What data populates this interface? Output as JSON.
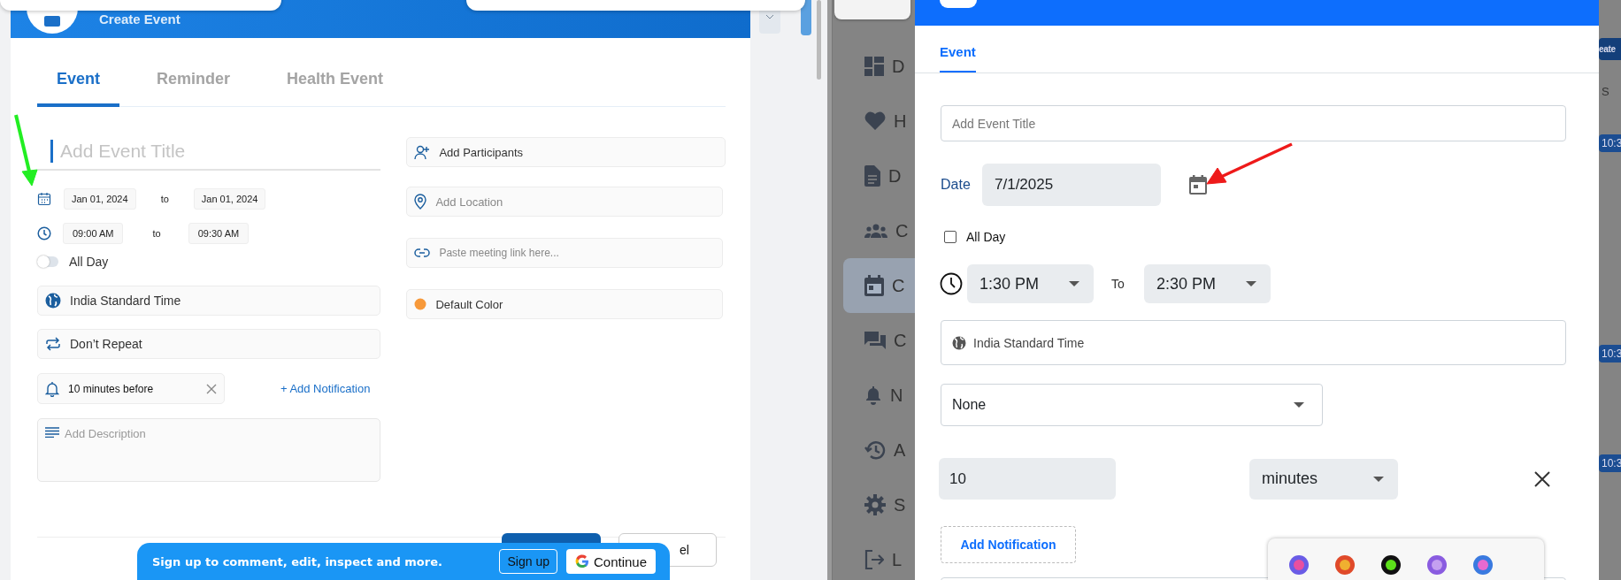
{
  "left_screen": {
    "header": {
      "title": "Create Event"
    },
    "tabs": [
      {
        "label": "Event",
        "selected": true
      },
      {
        "label": "Reminder",
        "selected": false
      },
      {
        "label": "Health Event",
        "selected": false
      }
    ],
    "title_field": {
      "placeholder": "Add Event Title"
    },
    "date_range": {
      "start": "Jan 01, 2024",
      "separator": "to",
      "end": "Jan 01, 2024"
    },
    "time_range": {
      "start": "09:00 AM",
      "separator": "to",
      "end": "09:30 AM"
    },
    "all_day": {
      "label": "All Day",
      "on": false
    },
    "timezone": "India Standard Time",
    "repeat": "Don’t Repeat",
    "notification": {
      "value": "10 minutes before",
      "add_link": "+ Add Notification"
    },
    "description": {
      "placeholder": "Add Description"
    },
    "participants": {
      "placeholder": "Add Participants"
    },
    "location": {
      "placeholder": "Add Location"
    },
    "meeting_link": {
      "placeholder": "Paste meeting link here..."
    },
    "color": {
      "label": "Default Color"
    },
    "cancel_button": "el",
    "signup_banner": {
      "text": "Sign up to comment, edit, inspect and more.",
      "signup": "Sign up",
      "continue": "Continue"
    }
  },
  "right_screen": {
    "sidebar": [
      {
        "label": "D",
        "selected": false
      },
      {
        "label": "H",
        "selected": false
      },
      {
        "label": "D",
        "selected": false
      },
      {
        "label": "C",
        "selected": false
      },
      {
        "label": "C",
        "selected": true
      },
      {
        "label": "C",
        "selected": false
      },
      {
        "label": "N",
        "selected": false
      },
      {
        "label": "A",
        "selected": false
      },
      {
        "label": "S",
        "selected": false
      },
      {
        "label": "L",
        "selected": false
      }
    ],
    "tabs": [
      {
        "label": "Event",
        "selected": true
      }
    ],
    "title_field": {
      "placeholder": "Add Event Title"
    },
    "date": {
      "label": "Date",
      "value": "7/1/2025"
    },
    "all_day": {
      "label": "All Day",
      "checked": false
    },
    "time": {
      "start": "1:30 PM",
      "separator": "To",
      "end": "2:30 PM"
    },
    "timezone": "India Standard Time",
    "repeat": "None",
    "notification": {
      "amount": "10",
      "unit": "minutes"
    },
    "add_notification": "Add Notification",
    "background": {
      "create_button": "eate",
      "column_label": "S",
      "event_badges": [
        "10:3",
        "10:3",
        "10:3"
      ]
    }
  }
}
